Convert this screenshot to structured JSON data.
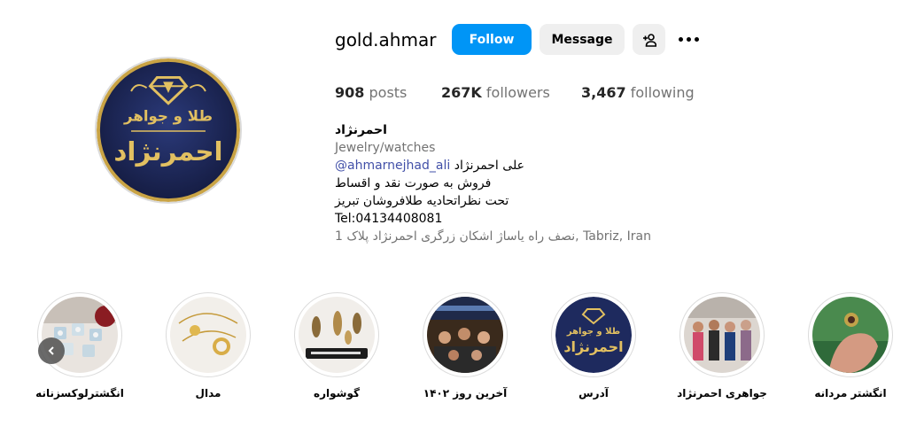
{
  "profile": {
    "username": "gold.ahmar",
    "avatar_logo_text_small": "طلا و جواهر",
    "avatar_logo_text_big": "احمرنژاد"
  },
  "actions": {
    "follow_label": "Follow",
    "message_label": "Message",
    "add_user_icon": "person-add-icon",
    "more_icon": "more-options-icon"
  },
  "stats": {
    "posts_count": "908",
    "posts_label": "posts",
    "followers_count": "267K",
    "followers_label": "followers",
    "following_count": "3,467",
    "following_label": "following"
  },
  "bio": {
    "name": "احمرنژاد",
    "category": "Jewelry/watches",
    "mention": "@ahmarnejhad_ali",
    "mention_prefix": "علی احمرنژاد",
    "line2": "فروش به صورت نقد و اقساط",
    "line3": "تحت نظراتحادیه طلافروشان تبریز",
    "phone": "Tel:04134408081",
    "address": "نصف راه یاساژ اشکان زرگری احمرنژاد پلاک 1, Tabriz, Iran"
  },
  "highlights": [
    {
      "label": "انگشتر مردانه"
    },
    {
      "label": "جواهری احمرنژاد"
    },
    {
      "label": "آدرس"
    },
    {
      "label": "آخرین روز ۱۴۰۲"
    },
    {
      "label": "گوشواره"
    },
    {
      "label": "مدال"
    },
    {
      "label": "انگشترلوکسزنانه"
    }
  ],
  "colors": {
    "follow_button": "#0095f6",
    "secondary_button": "#efefef",
    "mention_link": "#4250a8",
    "logo_navy": "#1e2a5e",
    "logo_gold": "#d9b24a"
  }
}
